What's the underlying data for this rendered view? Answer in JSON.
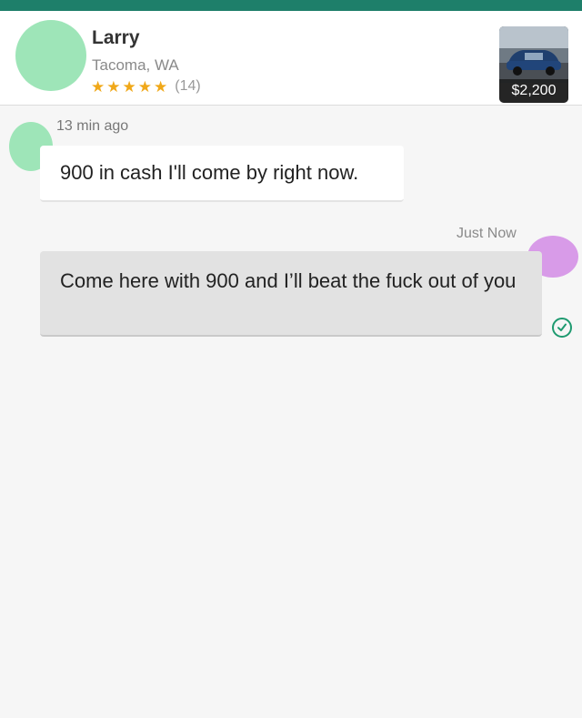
{
  "header": {
    "seller_name": "Larry",
    "location": "Tacoma, WA",
    "rating_stars": 5,
    "review_count": "(14)",
    "listing_price": "$2,200",
    "listing_thumbnail_icon": "car-photo-icon"
  },
  "messages": [
    {
      "direction": "incoming",
      "timestamp": "13 min ago",
      "text": "900 in cash I'll come by right now."
    },
    {
      "direction": "outgoing",
      "timestamp": "Just Now",
      "text": "Come here with 900 and I’ll beat the fuck out of you",
      "status_icon": "read-check-icon"
    }
  ],
  "colors": {
    "accent": "#1e7f6a",
    "star": "#f0a819",
    "incoming_bubble": "#ffffff",
    "outgoing_bubble": "#e2e2e2",
    "check": "#1e9a70"
  }
}
